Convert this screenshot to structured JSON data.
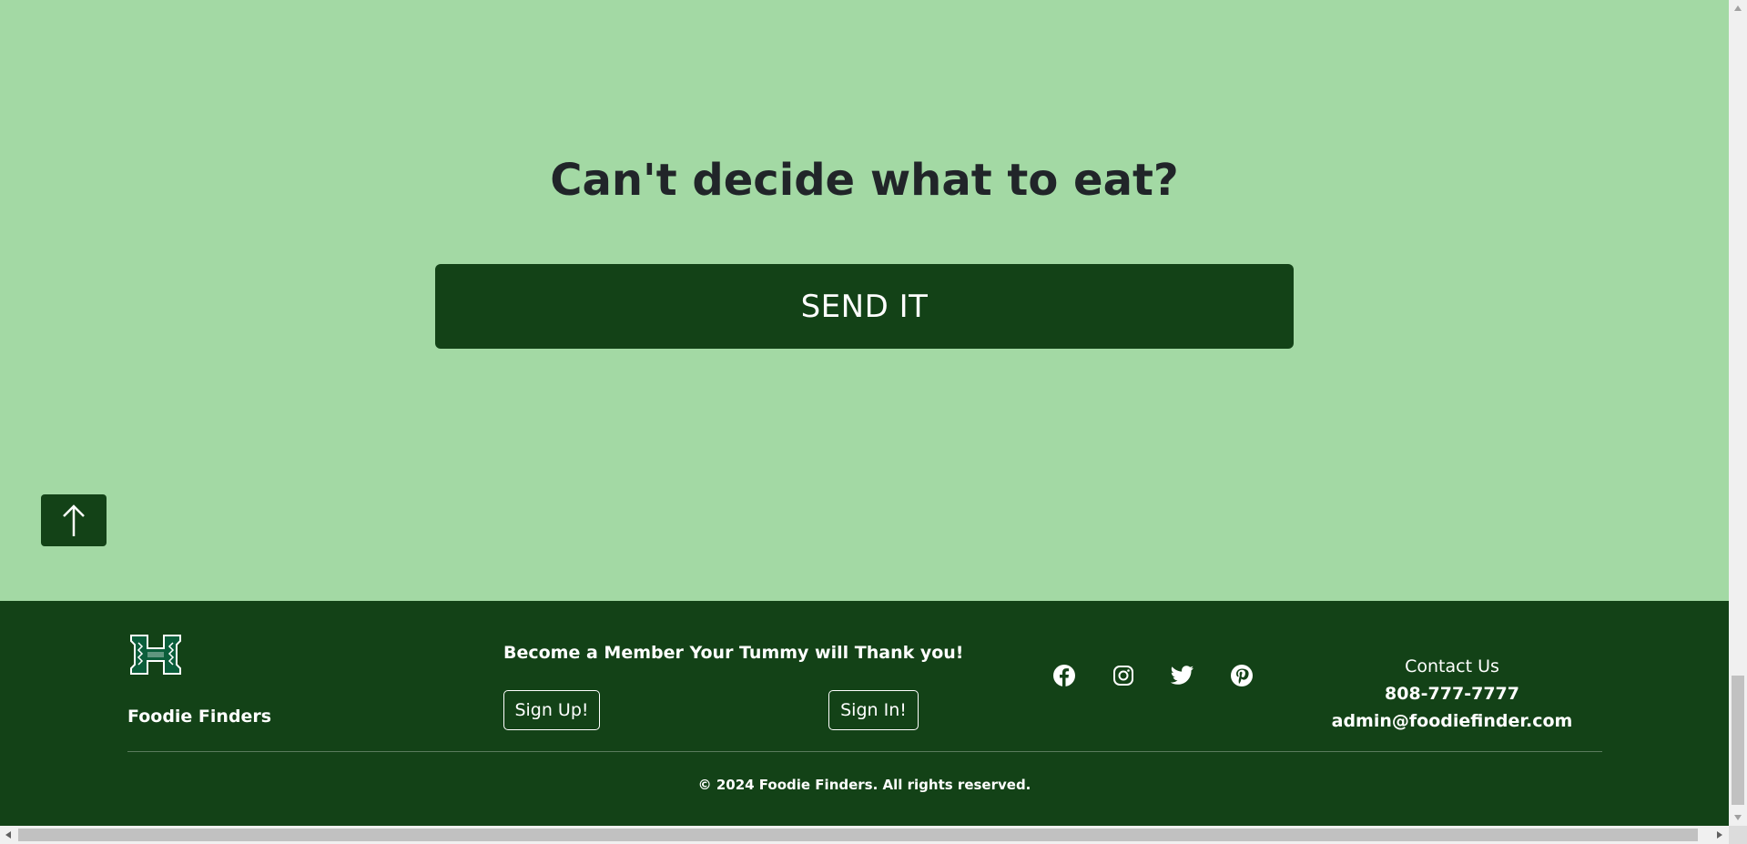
{
  "hero": {
    "title": "Can't decide what to eat?",
    "send_button_label": "SEND IT"
  },
  "scroll_top": {
    "icon": "arrow-up-icon"
  },
  "footer": {
    "brand_name": "Foodie Finders",
    "logo_icon": "university-h-logo",
    "member_text": "Become a Member Your Tummy will Thank you!",
    "signup_label": "Sign Up!",
    "signin_label": "Sign In!",
    "social_icons": [
      "facebook-icon",
      "instagram-icon",
      "twitter-icon",
      "pinterest-icon"
    ],
    "contact": {
      "title": "Contact Us",
      "phone": "808-777-7777",
      "email": "admin@foodiefinder.com"
    },
    "copyright": "© 2024 Foodie Finders. All rights reserved."
  },
  "colors": {
    "page_background": "#a3d9a4",
    "brand_green": "#134217",
    "text_dark": "#212529",
    "white": "#ffffff"
  }
}
